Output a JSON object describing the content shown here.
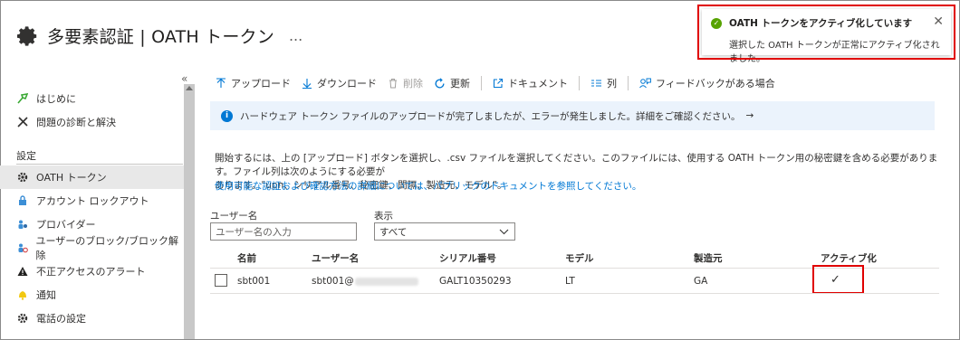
{
  "page": {
    "title": "多要素認証 | OATH トークン",
    "more": "..."
  },
  "sidebar": {
    "collapse": "«",
    "items": [
      {
        "label": "はじめに",
        "icon": "quickstart-icon"
      },
      {
        "label": "問題の診断と解決",
        "icon": "wrench-icon"
      }
    ],
    "section": "設定",
    "settings": [
      {
        "label": "OATH トークン",
        "icon": "gear-icon",
        "active": true
      },
      {
        "label": "アカウント ロックアウト",
        "icon": "lock-icon"
      },
      {
        "label": "プロバイダー",
        "icon": "providers-icon"
      },
      {
        "label": "ユーザーのブロック/ブロック解除",
        "icon": "block-users-icon"
      },
      {
        "label": "不正アクセスのアラート",
        "icon": "warning-icon"
      },
      {
        "label": "通知",
        "icon": "bell-icon"
      },
      {
        "label": "電話の設定",
        "icon": "gear-icon"
      }
    ]
  },
  "toolbar": {
    "upload": "アップロード",
    "download": "ダウンロード",
    "delete": "削除",
    "refresh": "更新",
    "documents": "ドキュメント",
    "columns": "列",
    "feedback": "フィードバックがある場合"
  },
  "info": {
    "text": "ハードウェア トークン ファイルのアップロードが完了しましたが、エラーが発生しました。詳細をご確認ください。",
    "arrow": "→"
  },
  "description": {
    "line1": "開始するには、上の [アップロード] ボタンを選択し、.csv ファイルを選択してください。このファイルには、使用する OATH トークン用の秘密鍵を含める必要があります。ファイル列は次のようにする必要が",
    "line2": "あります。\"upn、シリアル番号、秘密鍵、間隔、製造元、モデル\"。",
    "link": "使用可能な認証および確認方法の詳細については、パブリックのドキュメントを参照してください。"
  },
  "filters": {
    "username_label": "ユーザー名",
    "username_placeholder": "ユーザー名の入力",
    "show_label": "表示",
    "show_value": "すべて"
  },
  "table": {
    "columns": [
      "名前",
      "ユーザー名",
      "シリアル番号",
      "モデル",
      "製造元",
      "アクティブ化"
    ],
    "rows": [
      {
        "name": "sbt001",
        "username": "sbt001@",
        "serial": "GALT10350293",
        "model": "LT",
        "manufacturer": "GA",
        "activated": "✓"
      }
    ]
  },
  "toast": {
    "title": "OATH トークンをアクティブ化しています",
    "message": "選択した OATH トークンが正常にアクティブ化されました。",
    "close": "✕"
  },
  "colors": {
    "accent": "#0078d4",
    "success": "#57a300",
    "highlight": "#e00000",
    "info_bg": "#ebf3fc"
  }
}
